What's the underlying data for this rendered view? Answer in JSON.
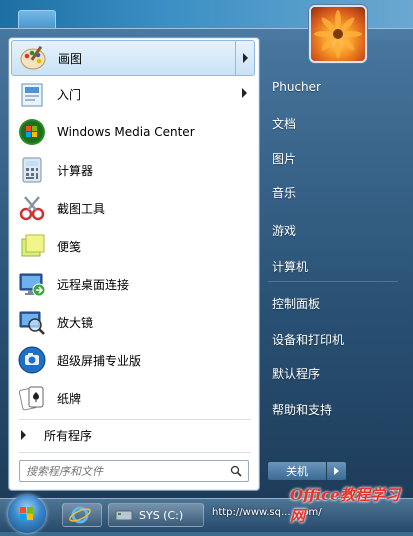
{
  "programs": [
    {
      "label": "画图",
      "icon": "paint-icon",
      "submenu": true
    },
    {
      "label": "入门",
      "icon": "getting-started-icon",
      "submenu": true
    },
    {
      "label": "Windows Media Center",
      "icon": "windows-media-center-icon",
      "submenu": false
    },
    {
      "label": "计算器",
      "icon": "calculator-icon",
      "submenu": false
    },
    {
      "label": "截图工具",
      "icon": "snipping-tool-icon",
      "submenu": false
    },
    {
      "label": "便笺",
      "icon": "sticky-notes-icon",
      "submenu": false
    },
    {
      "label": "远程桌面连接",
      "icon": "remote-desktop-icon",
      "submenu": false
    },
    {
      "label": "放大镜",
      "icon": "magnifier-icon",
      "submenu": false
    },
    {
      "label": "超级屏捕专业版",
      "icon": "screen-capture-icon",
      "submenu": false
    },
    {
      "label": "纸牌",
      "icon": "solitaire-icon",
      "submenu": false
    }
  ],
  "all_programs_label": "所有程序",
  "search": {
    "placeholder": "搜索程序和文件"
  },
  "right_pane": {
    "user_name": "Phucher",
    "items": [
      "文档",
      "图片",
      "音乐",
      "游戏",
      "计算机",
      "控制面板",
      "设备和打印机",
      "默认程序",
      "帮助和支持"
    ]
  },
  "shutdown_label": "关机",
  "taskbar": {
    "drive_label": "SYS (C:)"
  },
  "watermark": {
    "url": "http://www.sq... .com/",
    "logo": "Office教程学习网"
  }
}
